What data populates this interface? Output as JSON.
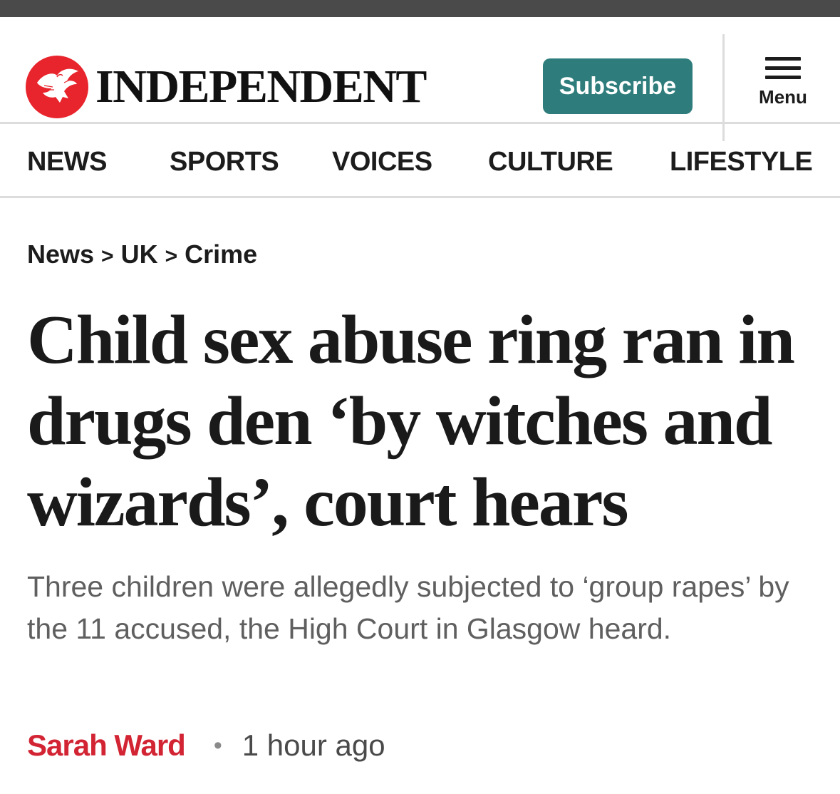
{
  "header": {
    "brand": "INDEPENDENT",
    "subscribe_label": "Subscribe",
    "menu_label": "Menu"
  },
  "nav": {
    "items": [
      "NEWS",
      "SPORTS",
      "VOICES",
      "CULTURE",
      "LIFESTYLE"
    ]
  },
  "breadcrumb": [
    "News",
    "UK",
    "Crime"
  ],
  "article": {
    "headline": "Child sex abuse ring ran in drugs den ‘by witches and wizards’, court hears",
    "standfirst": "Three children were allegedly subjected to ‘group rapes’ by the 11 accused, the High Court in Glasgow heard.",
    "author": "Sarah Ward",
    "time": "1 hour ago"
  },
  "colors": {
    "brand_red": "#e8242c",
    "subscribe_teal": "#2e7d7c",
    "author_red": "#d22433"
  },
  "icons": {
    "logo": "eagle-icon",
    "menu": "hamburger-menu-icon",
    "breadcrumb_separator": "chevron-right-icon"
  }
}
